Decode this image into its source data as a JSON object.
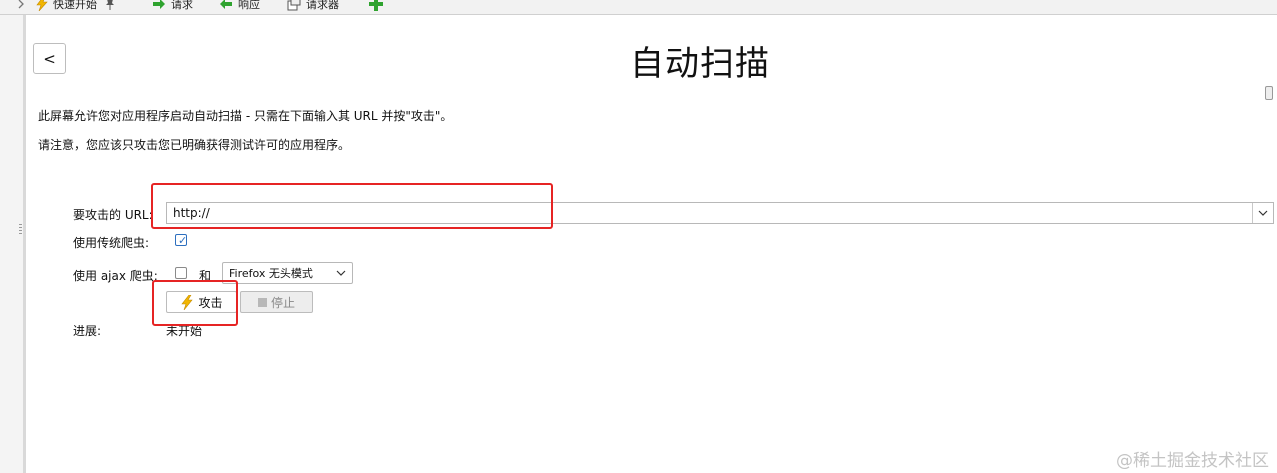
{
  "toolbar": {
    "quick_start": "快速开始",
    "request": "请求",
    "response": "响应",
    "requester": "请求器"
  },
  "header": {
    "back_label": "<",
    "title": "自动扫描"
  },
  "intro": {
    "line1": "此屏幕允许您对应用程序启动自动扫描 - 只需在下面输入其 URL 并按\"攻击\"。",
    "line2": "请注意，您应该只攻击您已明确获得测试许可的应用程序。"
  },
  "form": {
    "url_label": "要攻击的 URL:",
    "url_value": "http://",
    "traditional_spider_label": "使用传统爬虫:",
    "traditional_spider_checked": true,
    "ajax_spider_label": "使用 ajax 爬虫:",
    "ajax_spider_checked": false,
    "and_label": "和",
    "browser_selected": "Firefox 无头模式",
    "attack_label": "攻击",
    "stop_label": "停止",
    "progress_label": "进展:",
    "progress_value": "未开始"
  },
  "watermark": "@稀土掘金技术社区",
  "colors": {
    "highlight_box": "#e62424",
    "checkbox_accent": "#2d6fbf",
    "add_icon": "#2fa32f",
    "lightning_icon": "#f2b600"
  },
  "icons": {
    "quick_start": "lightning-icon",
    "request": "green-arrow-right-icon",
    "response": "green-arrow-left-icon",
    "requester": "requester-icon",
    "add": "plus-icon",
    "attack": "lightning-icon",
    "stop": "stop-square-icon"
  }
}
